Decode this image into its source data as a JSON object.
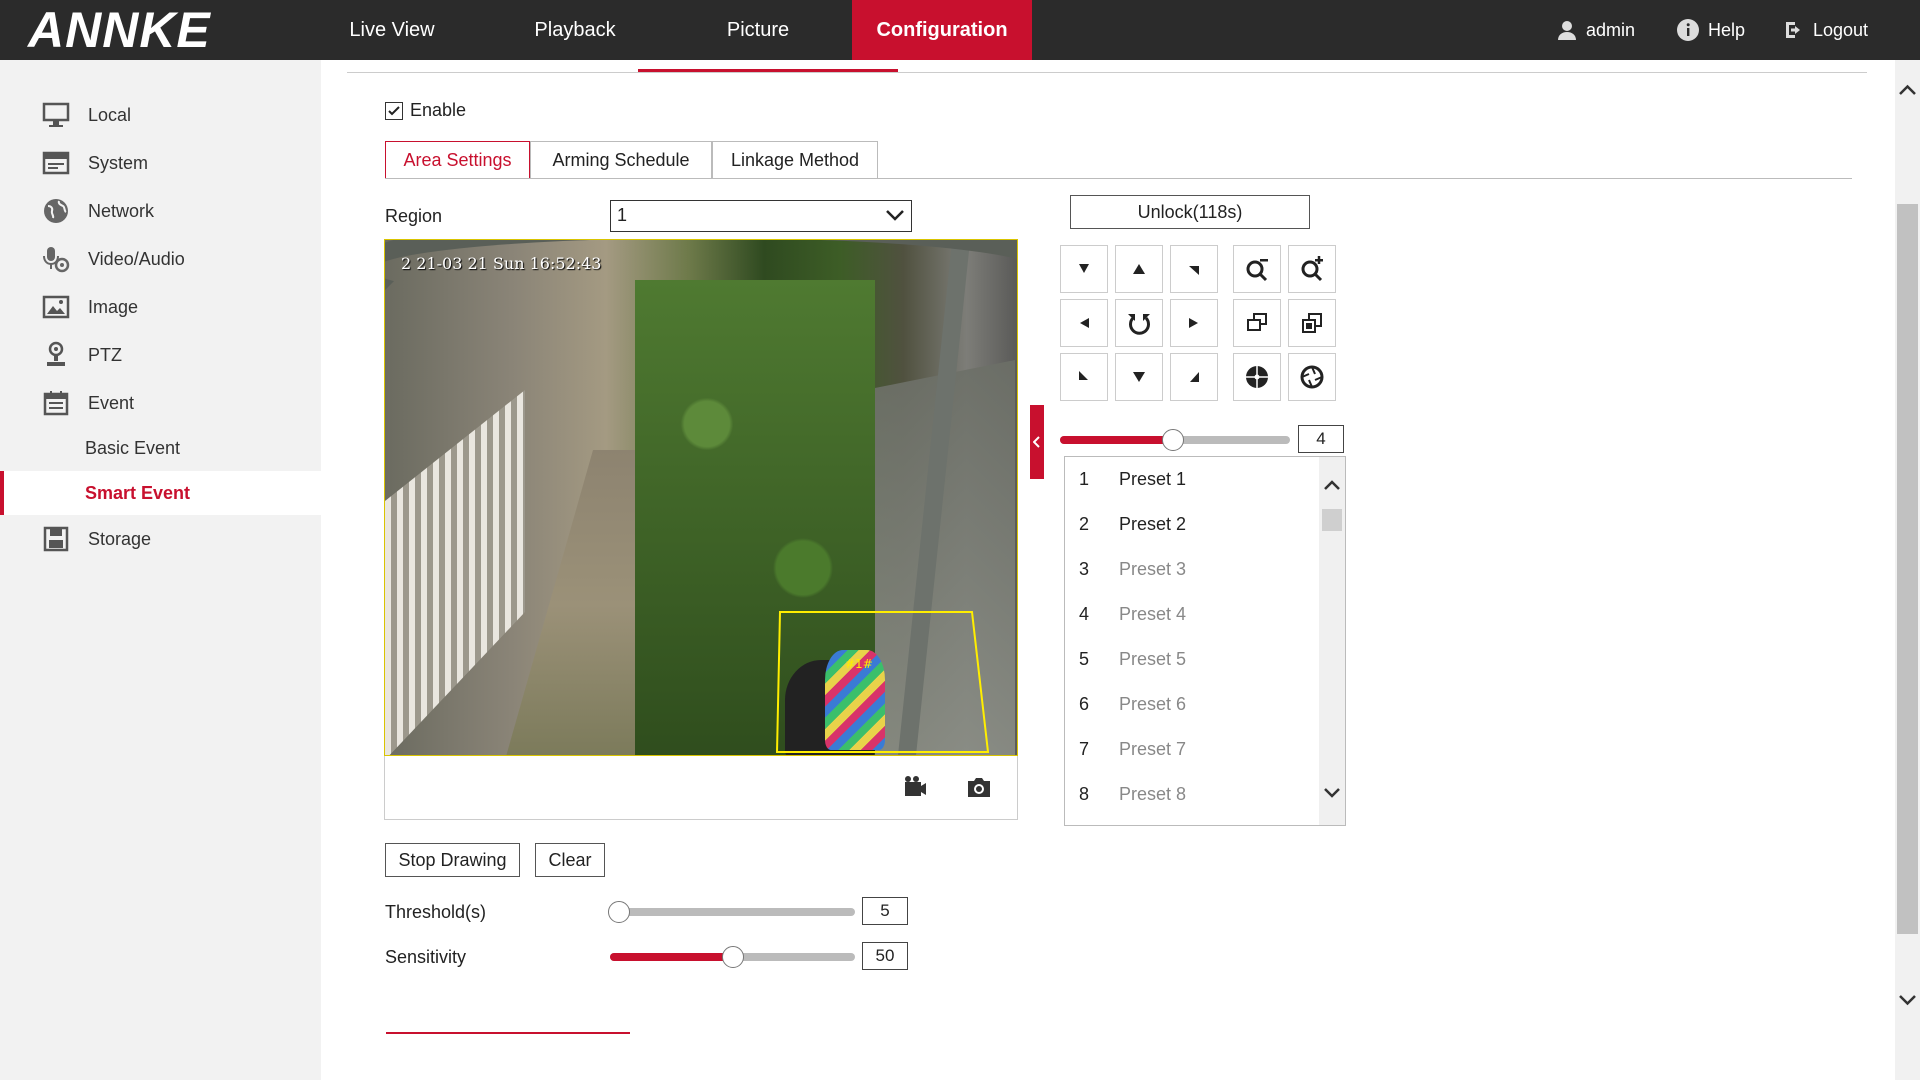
{
  "brand": "ANNKE",
  "nav": {
    "live_view": "Live View",
    "playback": "Playback",
    "picture": "Picture",
    "configuration": "Configuration"
  },
  "user": {
    "name": "admin",
    "help": "Help",
    "logout": "Logout"
  },
  "sidebar": {
    "items": [
      {
        "label": "Local",
        "icon": "monitor-icon"
      },
      {
        "label": "System",
        "icon": "system-icon"
      },
      {
        "label": "Network",
        "icon": "globe-icon"
      },
      {
        "label": "Video/Audio",
        "icon": "microphone-icon"
      },
      {
        "label": "Image",
        "icon": "image-icon"
      },
      {
        "label": "PTZ",
        "icon": "ptz-icon"
      },
      {
        "label": "Event",
        "icon": "calendar-icon"
      },
      {
        "label": "Storage",
        "icon": "storage-icon"
      }
    ],
    "event_sub": {
      "basic": "Basic Event",
      "smart": "Smart Event"
    }
  },
  "main": {
    "enable_label": "Enable",
    "enable_checked": true,
    "tabs": [
      "Area Settings",
      "Arming Schedule",
      "Linkage Method"
    ],
    "active_tab": "Area Settings",
    "region_label": "Region",
    "region_value": "1",
    "osd_text": "2 21-03 21 Sun 16:52:43",
    "stop_drawing": "Stop Drawing",
    "clear": "Clear",
    "threshold_label": "Threshold(s)",
    "threshold_value": "5",
    "threshold_fraction": 0.0,
    "sensitivity_label": "Sensitivity",
    "sensitivity_value": "50",
    "sensitivity_fraction": 0.5
  },
  "ptz": {
    "unlock_label": "Unlock(118s)",
    "speed_value": "4",
    "speed_fraction": 0.49,
    "presets": [
      {
        "num": "1",
        "label": "Preset 1",
        "set": true
      },
      {
        "num": "2",
        "label": "Preset 2",
        "set": true
      },
      {
        "num": "3",
        "label": "Preset 3",
        "set": false
      },
      {
        "num": "4",
        "label": "Preset 4",
        "set": false
      },
      {
        "num": "5",
        "label": "Preset 5",
        "set": false
      },
      {
        "num": "6",
        "label": "Preset 6",
        "set": false
      },
      {
        "num": "7",
        "label": "Preset 7",
        "set": false
      },
      {
        "num": "8",
        "label": "Preset 8",
        "set": false
      }
    ]
  },
  "colors": {
    "accent": "#c8102e",
    "header": "#2b2b2b",
    "sidebar": "#f2f2f2",
    "region": "#ffee00"
  }
}
